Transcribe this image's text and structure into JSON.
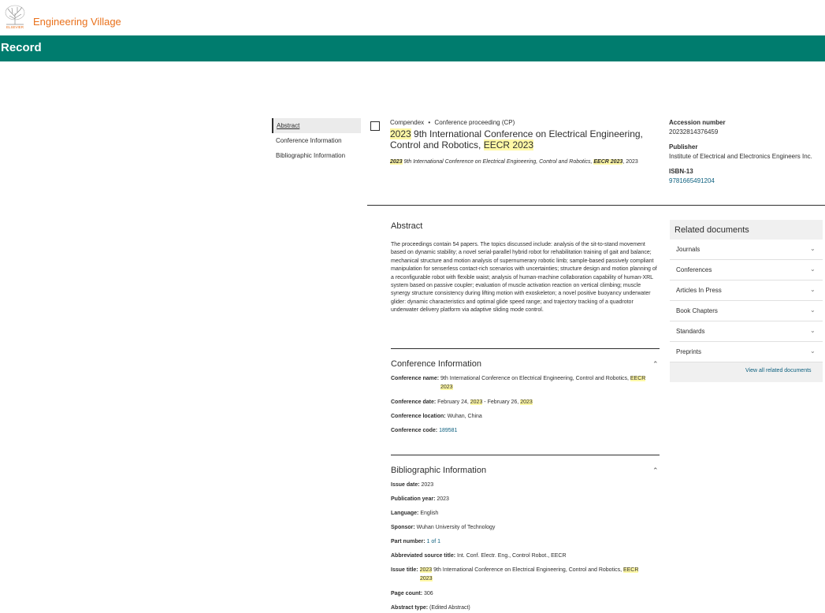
{
  "header": {
    "logo_text": "ELSEVIER",
    "brand": "Engineering Village",
    "record_title": "Record"
  },
  "nav": {
    "items": [
      "Abstract",
      "Conference Information",
      "Bibliographic Information"
    ]
  },
  "record": {
    "database": "Compendex",
    "separator": "•",
    "doc_type": "Conference proceeding (CP)",
    "title": {
      "year": "2023",
      "main": " 9th International Conference on Electrical Engineering, Control and Robotics, ",
      "acronym": "EECR 2023"
    },
    "source": {
      "year": "2023",
      "main": " 9th International Conference on Electrical Engineering, Control and Robotics, ",
      "acronym": "EECR 2023",
      "tail": ", 2023"
    }
  },
  "meta": {
    "accession_label": "Accession number",
    "accession_value": "20232814376459",
    "publisher_label": "Publisher",
    "publisher_value": "Institute of Electrical and Electronics Engineers Inc.",
    "isbn_label": "ISBN-13",
    "isbn_value": "9781665491204"
  },
  "abstract": {
    "heading": "Abstract",
    "text": "The proceedings contain 54 papers. The topics discussed include: analysis of the sit-to-stand movement based on dynamic stability; a novel serial-parallel hybrid robot for rehabilitation training of gait and balance; mechanical structure and motion analysis of supernumerary robotic limb; sample-based passively compliant manipulation for senserless contact-rich scenarios with uncertainties; structure design and motion planning of a reconfigurable robot with flexible waist; analysis of human-machine collaboration capability of human-XRL system based on passive coupler; evaluation of muscle activation reaction on vertical climbing; muscle synergy structure consistency during lifting motion with exoskeleton; a novel positive buoyancy underwater glider: dynamic characteristics and optimal glide speed range; and trajectory tracking of a quadrotor underwater delivery platform via adaptive sliding mode control."
  },
  "conference": {
    "heading": "Conference Information",
    "name_label": "Conference name:",
    "name_main": " 9th International Conference on Electrical Engineering, Control and Robotics, ",
    "name_hl1": "EECR",
    "name_hl2": "2023",
    "date_label": "Conference date:",
    "date_a": " February 24, ",
    "date_year1": "2023",
    "date_b": " - February 26, ",
    "date_year2": "2023",
    "location_label": "Conference location:",
    "location_value": " Wuhan, China",
    "code_label": "Conference code:",
    "code_value": "189581"
  },
  "biblio": {
    "heading": "Bibliographic Information",
    "issue_date_label": "Issue date:",
    "issue_date_value": " 2023",
    "pub_year_label": "Publication year:",
    "pub_year_value": " 2023",
    "language_label": "Language:",
    "language_value": " English",
    "sponsor_label": "Sponsor:",
    "sponsor_value": " Wuhan University of Technology",
    "part_label": "Part number:",
    "part_value": "1 of 1",
    "abbr_label": "Abbreviated source title:",
    "abbr_value": " Int. Conf. Electr. Eng., Control Robot., EECR",
    "issue_title_label": "Issue title:",
    "issue_title_year": "2023",
    "issue_title_main": " 9th International Conference on Electrical Engineering, Control and Robotics, ",
    "issue_title_hl1": "EECR",
    "issue_title_hl2": "2023",
    "page_count_label": "Page count:",
    "page_count_value": " 306",
    "abstract_type_label": "Abstract type:",
    "abstract_type_value": " (Edited Abstract)"
  },
  "related": {
    "heading": "Related documents",
    "items": [
      "Journals",
      "Conferences",
      "Articles In Press",
      "Book Chapters",
      "Standards",
      "Preprints"
    ],
    "view_all": "View all related documents"
  },
  "colors": {
    "brand_orange": "#e9711c",
    "record_bar": "#007c6e",
    "highlight": "#fff8a6",
    "link": "#0b5f7e"
  }
}
